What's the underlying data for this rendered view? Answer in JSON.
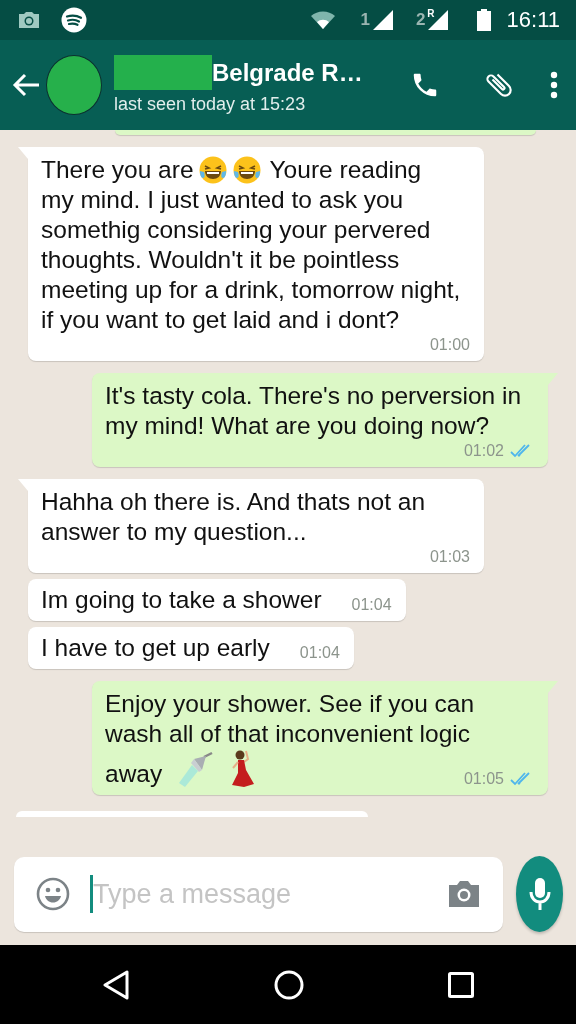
{
  "status_bar": {
    "sim_1": "1",
    "sim_2": "2",
    "roaming": "R",
    "time": "16:11"
  },
  "header": {
    "name": "Belgrade R…",
    "status": "last seen today at 15:23"
  },
  "messages": [
    {
      "outgoing": false,
      "kind": "lead_emoji",
      "lead": "There you are",
      "lead_after": "Youre reading",
      "text": "my mind. I just wanted to ask you somethig considering your pervered thoughts. Wouldn't it be pointless meeting up for a drink, tomorrow night, if you want to get laid and i dont?",
      "time": "01:00"
    },
    {
      "outgoing": true,
      "kind": "plain",
      "text": "It's tasty cola. There's no perversion in my mind! What are you doing now?",
      "time": "01:02",
      "read": true
    },
    {
      "outgoing": false,
      "kind": "plain",
      "text": "Hahha oh there is. And thats not an answer to my question...",
      "time": "01:03"
    },
    {
      "outgoing": false,
      "kind": "short",
      "text": "Im going to take a shower",
      "time": "01:04"
    },
    {
      "outgoing": false,
      "kind": "short",
      "text": "I have to get up early",
      "time": "01:04"
    },
    {
      "outgoing": true,
      "kind": "trail_emoji",
      "text": "Enjoy your shower. See if you can wash all of that inconvenient logic",
      "tail": "away",
      "time": "01:05",
      "read": true
    }
  ],
  "composer": {
    "placeholder": "Type a message"
  }
}
